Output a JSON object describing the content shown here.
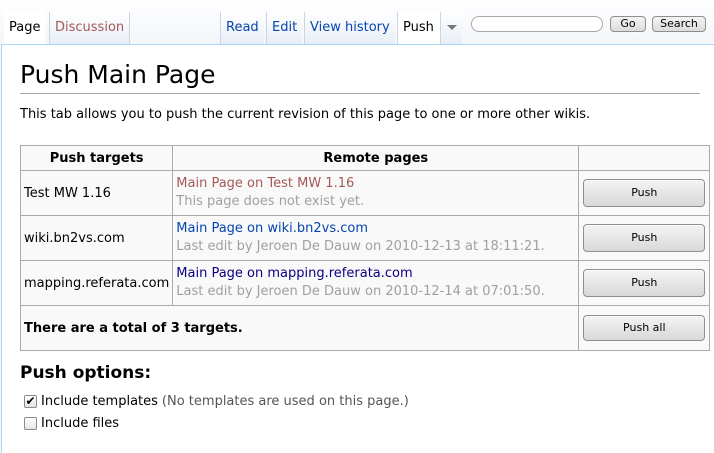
{
  "tabs": {
    "page": "Page",
    "discussion": "Discussion",
    "read": "Read",
    "edit": "Edit",
    "view_history": "View history",
    "push": "Push"
  },
  "search": {
    "value": "",
    "go_label": "Go",
    "search_label": "Search"
  },
  "page": {
    "title": "Push Main Page",
    "intro": "This tab allows you to push the current revision of this page to one or more other wikis."
  },
  "table": {
    "headers": [
      "Push targets",
      "Remote pages",
      ""
    ],
    "rows": [
      {
        "target": "Test MW 1.16",
        "link": "Main Page on Test MW 1.16",
        "note": "This page does not exist yet.",
        "button": "Push"
      },
      {
        "target": "wiki.bn2vs.com",
        "link": "Main Page on wiki.bn2vs.com",
        "note": "Last edit by Jeroen De Dauw on 2010-12-13 at 18:11:21.",
        "button": "Push"
      },
      {
        "target": "mapping.referata.com",
        "link": "Main Page on mapping.referata.com",
        "note": "Last edit by Jeroen De Dauw on 2010-12-14 at 07:01:50.",
        "button": "Push"
      }
    ],
    "total_text": "There are a total of 3 targets.",
    "push_all_label": "Push all"
  },
  "options": {
    "title": "Push options:",
    "include_templates": {
      "label": "Include templates",
      "note": "(No templates are used on this page.)",
      "checked": true
    },
    "include_files": {
      "label": "Include files",
      "checked": false
    }
  },
  "colors": {
    "link_blue": "#0645ad",
    "link_visited": "#0b0080",
    "link_new": "#a55858",
    "border_blue": "#a7d7f9"
  },
  "icons": {
    "tab_dropdown": "chevron-down-icon",
    "checkmark": "check-icon"
  }
}
